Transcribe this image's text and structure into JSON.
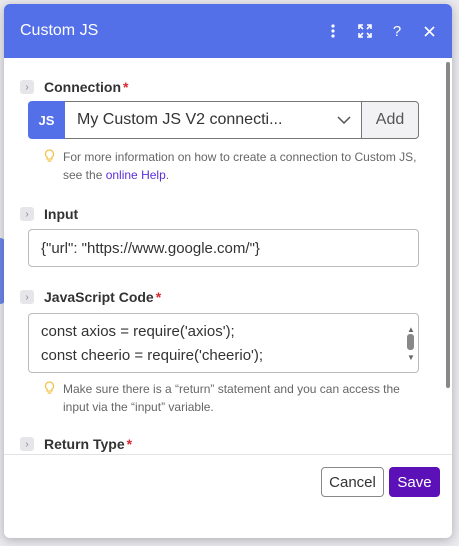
{
  "dialog": {
    "title": "Custom JS",
    "header_icons": [
      "more-vertical-icon",
      "expand-icon",
      "help-icon",
      "close-icon"
    ]
  },
  "connection": {
    "label": "Connection",
    "required_mark": "*",
    "badge": "JS",
    "selected": "My Custom JS V2 connecti...",
    "add_label": "Add",
    "hint_text": "For more information on how to create a connection to Custom JS, see the ",
    "hint_link": "online Help",
    "hint_end": "."
  },
  "input": {
    "label": "Input",
    "value": "{\"url\": \"https://www.google.com/\"}"
  },
  "code": {
    "label": "JavaScript Code",
    "required_mark": "*",
    "lines": [
      "const axios = require('axios');",
      "const cheerio = require('cheerio');"
    ],
    "hint_text": "Make sure there is a “return” statement and you can access the input via the “input” variable."
  },
  "return_type": {
    "label": "Return Type",
    "required_mark": "*"
  },
  "footer": {
    "cancel_label": "Cancel",
    "save_label": "Save"
  },
  "colors": {
    "header": "#5370e9",
    "save": "#5c10b8",
    "required": "#d9272f",
    "link": "#5c2fd8"
  }
}
